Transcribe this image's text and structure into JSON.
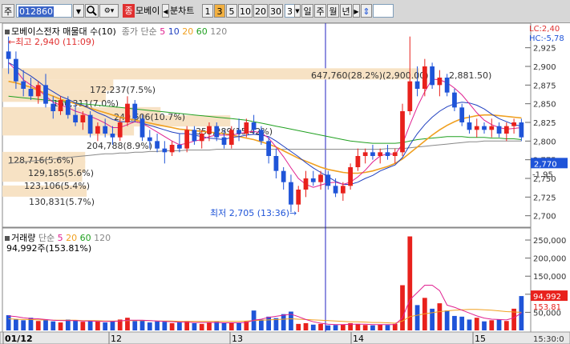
{
  "toolbar": {
    "mode": "주",
    "code": "012860",
    "stock_btn": "종",
    "stock_name": "모베이",
    "period_label": "분차트",
    "periods": [
      "1",
      "3",
      "5",
      "10",
      "20",
      "30"
    ],
    "active_period": "3",
    "count": "3",
    "ranges": [
      "일",
      "주",
      "월",
      "년"
    ]
  },
  "price_panel": {
    "legend_name": "모베이스전자 매물대 수(10)",
    "legend_ma_label": "종가 단순",
    "ma_periods": [
      "5",
      "10",
      "20",
      "60",
      "120"
    ],
    "lc": "LC:2,40",
    "hc": "HC:-5,78",
    "high_label": "최고 2,940 (11:09)",
    "low_label": "최저 2,705 (13:36)",
    "profile_labels": [
      "172,237(7.5%)",
      "160,311(7.0%)",
      "240,606(10.7%)",
      "204,788(8.9%)",
      "353,289(15.42%)",
      "128,716(5.6%)",
      "129,185(5.6%)",
      "123,106(5.4%)",
      "130,831(5.7%)",
      "647,760(28.2%)(2,900.00)",
      "2,881.50)"
    ],
    "y_ticks": [
      "2,925",
      "2,900",
      "2,875",
      "2,850",
      "2,825",
      "2,800",
      "2,775",
      "2,750",
      "2,725",
      "2,700"
    ],
    "current_price": "2,770",
    "side_value": "-1.95"
  },
  "volume_panel": {
    "legend_name": "거래량",
    "legend_ma_label": "단순",
    "ma_periods": [
      "5",
      "20",
      "60",
      "120"
    ],
    "last_volume": "94,992주(153.81%)",
    "y_ticks": [
      "250,000",
      "200,000",
      "150,000",
      "100,000",
      "50,000"
    ],
    "current_volume": "94,992",
    "current_pct": "153.81"
  },
  "x_axis": {
    "labels": [
      "01/12",
      "12",
      "13",
      "14",
      "15"
    ],
    "time": "15:30:0"
  },
  "colors": {
    "up": "#e8211c",
    "down": "#1f54d8",
    "ma5": "#e02090",
    "ma10": "#2040c0",
    "ma20": "#f0a020",
    "ma60": "#20a020",
    "ma120": "#888888"
  },
  "chart_data": {
    "type": "candlestick",
    "y_range": [
      2690,
      2945
    ],
    "volume_range": [
      0,
      270000
    ],
    "candles": [
      [
        2920,
        2940,
        2890,
        2910
      ],
      [
        2910,
        2920,
        2870,
        2880
      ],
      [
        2880,
        2895,
        2860,
        2870
      ],
      [
        2870,
        2885,
        2855,
        2860
      ],
      [
        2860,
        2880,
        2850,
        2875
      ],
      [
        2875,
        2890,
        2845,
        2850
      ],
      [
        2850,
        2860,
        2830,
        2840
      ],
      [
        2840,
        2860,
        2835,
        2855
      ],
      [
        2855,
        2860,
        2830,
        2835
      ],
      [
        2835,
        2850,
        2820,
        2825
      ],
      [
        2825,
        2840,
        2815,
        2835
      ],
      [
        2835,
        2840,
        2805,
        2810
      ],
      [
        2810,
        2825,
        2800,
        2820
      ],
      [
        2820,
        2830,
        2805,
        2810
      ],
      [
        2810,
        2820,
        2795,
        2805
      ],
      [
        2805,
        2830,
        2800,
        2825
      ],
      [
        2825,
        2860,
        2820,
        2850
      ],
      [
        2850,
        2855,
        2825,
        2830
      ],
      [
        2830,
        2835,
        2800,
        2805
      ],
      [
        2805,
        2815,
        2790,
        2800
      ],
      [
        2800,
        2810,
        2785,
        2790
      ],
      [
        2790,
        2800,
        2770,
        2785
      ],
      [
        2785,
        2800,
        2780,
        2795
      ],
      [
        2795,
        2810,
        2785,
        2790
      ],
      [
        2790,
        2820,
        2785,
        2815
      ],
      [
        2815,
        2820,
        2795,
        2800
      ],
      [
        2800,
        2815,
        2790,
        2810
      ],
      [
        2810,
        2825,
        2800,
        2820
      ],
      [
        2820,
        2825,
        2800,
        2805
      ],
      [
        2805,
        2815,
        2790,
        2795
      ],
      [
        2795,
        2820,
        2790,
        2815
      ],
      [
        2815,
        2830,
        2800,
        2810
      ],
      [
        2810,
        2830,
        2805,
        2825
      ],
      [
        2825,
        2835,
        2810,
        2815
      ],
      [
        2815,
        2820,
        2795,
        2800
      ],
      [
        2800,
        2805,
        2770,
        2780
      ],
      [
        2780,
        2790,
        2750,
        2760
      ],
      [
        2760,
        2765,
        2735,
        2745
      ],
      [
        2745,
        2755,
        2705,
        2715
      ],
      [
        2715,
        2740,
        2705,
        2735
      ],
      [
        2735,
        2760,
        2725,
        2750
      ],
      [
        2750,
        2760,
        2740,
        2745
      ],
      [
        2745,
        2760,
        2735,
        2755
      ],
      [
        2755,
        2760,
        2735,
        2740
      ],
      [
        2740,
        2750,
        2725,
        2730
      ],
      [
        2730,
        2745,
        2720,
        2740
      ],
      [
        2740,
        2770,
        2735,
        2765
      ],
      [
        2765,
        2790,
        2760,
        2780
      ],
      [
        2780,
        2790,
        2770,
        2785
      ],
      [
        2785,
        2795,
        2775,
        2780
      ],
      [
        2780,
        2790,
        2770,
        2785
      ],
      [
        2785,
        2795,
        2775,
        2780
      ],
      [
        2780,
        2790,
        2770,
        2785
      ],
      [
        2785,
        2850,
        2780,
        2840
      ],
      [
        2840,
        2940,
        2835,
        2880
      ],
      [
        2880,
        2900,
        2860,
        2870
      ],
      [
        2870,
        2910,
        2860,
        2900
      ],
      [
        2900,
        2905,
        2870,
        2875
      ],
      [
        2875,
        2895,
        2860,
        2885
      ],
      [
        2885,
        2890,
        2860,
        2865
      ],
      [
        2865,
        2870,
        2840,
        2845
      ],
      [
        2845,
        2850,
        2820,
        2825
      ],
      [
        2825,
        2835,
        2810,
        2815
      ],
      [
        2815,
        2830,
        2805,
        2820
      ],
      [
        2820,
        2825,
        2810,
        2815
      ],
      [
        2815,
        2830,
        2805,
        2820
      ],
      [
        2820,
        2825,
        2805,
        2810
      ],
      [
        2810,
        2825,
        2800,
        2820
      ],
      [
        2820,
        2830,
        2810,
        2825
      ],
      [
        2825,
        2830,
        2800,
        2805
      ]
    ],
    "volumes": [
      42000,
      30000,
      28000,
      35000,
      26000,
      30000,
      25000,
      22000,
      30000,
      28000,
      24000,
      27000,
      25000,
      22000,
      26000,
      30000,
      35000,
      26000,
      28000,
      22000,
      25000,
      24000,
      20000,
      22000,
      26000,
      20000,
      18000,
      22000,
      24000,
      20000,
      22000,
      20000,
      25000,
      55000,
      30000,
      38000,
      34000,
      45000,
      52000,
      18000,
      20000,
      16000,
      18000,
      14000,
      15000,
      16000,
      20000,
      18000,
      15000,
      14000,
      16000,
      15000,
      18000,
      125000,
      260000,
      70000,
      90000,
      60000,
      75000,
      55000,
      40000,
      38000,
      30000,
      35000,
      25000,
      28000,
      30000,
      26000,
      60000,
      94992
    ],
    "ma5": [
      2905,
      2895,
      2882,
      2875,
      2869,
      2860,
      2852,
      2848,
      2845,
      2840,
      2837,
      2833,
      2829,
      2824,
      2818,
      2818,
      2822,
      2826,
      2824,
      2818,
      2812,
      2806,
      2800,
      2795,
      2797,
      2800,
      2802,
      2806,
      2808,
      2808,
      2808,
      2810,
      2812,
      2813,
      2811,
      2804,
      2792,
      2779,
      2764,
      2750,
      2742,
      2738,
      2741,
      2744,
      2745,
      2742,
      2745,
      2752,
      2761,
      2772,
      2780,
      2783,
      2782,
      2796,
      2822,
      2846,
      2866,
      2883,
      2882,
      2878,
      2871,
      2862,
      2850,
      2838,
      2828,
      2822,
      2818,
      2816,
      2817,
      2818
    ],
    "ma10": [
      2905,
      2900,
      2893,
      2887,
      2880,
      2872,
      2866,
      2860,
      2856,
      2851,
      2848,
      2843,
      2838,
      2834,
      2829,
      2826,
      2826,
      2826,
      2824,
      2821,
      2818,
      2815,
      2812,
      2810,
      2810,
      2808,
      2806,
      2804,
      2803,
      2802,
      2805,
      2806,
      2808,
      2809,
      2808,
      2806,
      2800,
      2793,
      2786,
      2779,
      2771,
      2764,
      2758,
      2752,
      2746,
      2742,
      2742,
      2745,
      2750,
      2754,
      2760,
      2764,
      2768,
      2778,
      2795,
      2810,
      2822,
      2832,
      2840,
      2846,
      2850,
      2852,
      2851,
      2848,
      2843,
      2836,
      2830,
      2826,
      2822,
      2820
    ],
    "ma20": [
      2880,
      2878,
      2875,
      2872,
      2868,
      2864,
      2860,
      2856,
      2853,
      2850,
      2847,
      2844,
      2841,
      2838,
      2835,
      2832,
      2830,
      2828,
      2826,
      2824,
      2822,
      2820,
      2818,
      2816,
      2815,
      2814,
      2813,
      2812,
      2811,
      2810,
      2808,
      2806,
      2804,
      2802,
      2799,
      2796,
      2792,
      2787,
      2782,
      2777,
      2773,
      2769,
      2765,
      2762,
      2760,
      2758,
      2757,
      2757,
      2758,
      2760,
      2763,
      2766,
      2770,
      2776,
      2784,
      2792,
      2800,
      2808,
      2815,
      2821,
      2826,
      2830,
      2832,
      2834,
      2835,
      2835,
      2834,
      2833,
      2832,
      2831
    ],
    "ma60": [
      2860,
      2859,
      2858,
      2857,
      2856,
      2855,
      2854,
      2853,
      2852,
      2851,
      2850,
      2849,
      2848,
      2847,
      2846,
      2845,
      2844,
      2843,
      2842,
      2841,
      2840,
      2839,
      2838,
      2837,
      2836,
      2835,
      2834,
      2833,
      2832,
      2831,
      2830,
      2829,
      2828,
      2826,
      2824,
      2822,
      2820,
      2818,
      2816,
      2814,
      2812,
      2810,
      2808,
      2806,
      2804,
      2802,
      2800,
      2799,
      2798,
      2797,
      2797,
      2797,
      2797,
      2798,
      2800,
      2802,
      2803,
      2804,
      2805,
      2806,
      2806,
      2806,
      2805,
      2805,
      2805,
      2804,
      2804,
      2803,
      2803,
      2802
    ],
    "ma120": [
      2770,
      2771,
      2772,
      2773,
      2774,
      2775,
      2776,
      2777,
      2778,
      2779,
      2780,
      2781,
      2782,
      2783,
      2783,
      2784,
      2784,
      2785,
      2785,
      2786,
      2786,
      2787,
      2787,
      2787,
      2788,
      2788,
      2788,
      2788,
      2789,
      2789,
      2789,
      2789,
      2789,
      2789,
      2789,
      2789,
      2789,
      2789,
      2789,
      2789,
      2789,
      2789,
      2789,
      2789,
      2789,
      2789,
      2789,
      2789,
      2789,
      2789,
      2789,
      2790,
      2790,
      2790,
      2791,
      2792,
      2793,
      2794,
      2795,
      2796,
      2797,
      2798,
      2799,
      2799,
      2800,
      2800,
      2800,
      2800,
      2800,
      2800
    ],
    "vol_ma5": [
      40000,
      38000,
      35000,
      33000,
      32000,
      30000,
      28000,
      27000,
      27000,
      27000,
      26000,
      26000,
      25000,
      25000,
      25000,
      26000,
      28000,
      28000,
      28000,
      27000,
      26000,
      25000,
      24000,
      23000,
      23000,
      22000,
      22000,
      22000,
      22000,
      21000,
      21000,
      21000,
      22000,
      28000,
      31000,
      36000,
      39000,
      42000,
      45000,
      38000,
      30000,
      24000,
      20000,
      17000,
      16000,
      16000,
      17000,
      17000,
      17000,
      16000,
      16000,
      16000,
      16000,
      35000,
      85000,
      105000,
      125000,
      125000,
      110000,
      70000,
      64000,
      56000,
      48000,
      40000,
      34000,
      31000,
      30000,
      29000,
      35000,
      48000
    ],
    "vol_ma20": [
      32000,
      31000,
      30000,
      30000,
      29000,
      29000,
      28000,
      28000,
      28000,
      28000,
      27000,
      27000,
      27000,
      26000,
      26000,
      26000,
      27000,
      27000,
      27000,
      27000,
      26000,
      26000,
      26000,
      25000,
      25000,
      25000,
      25000,
      25000,
      25000,
      25000,
      25000,
      25000,
      26000,
      27000,
      28000,
      29000,
      30000,
      31000,
      32000,
      31000,
      30000,
      29000,
      28000,
      27000,
      26000,
      25000,
      24000,
      24000,
      23000,
      22000,
      22000,
      21000,
      20000,
      26000,
      38000,
      42000,
      46000,
      49000,
      52000,
      54000,
      56000,
      57000,
      58000,
      58000,
      57000,
      56000,
      54000,
      52000,
      51000,
      50000
    ],
    "volume_profile": [
      {
        "price": 2875,
        "pct": 7.5
      },
      {
        "price": 2860,
        "pct": 7.0
      },
      {
        "price": 2838,
        "pct": 10.7
      },
      {
        "price": 2815,
        "pct": 8.9
      },
      {
        "price": 2827,
        "pct": 15.42
      },
      {
        "price": 2778,
        "pct": 5.6
      },
      {
        "price": 2766,
        "pct": 5.6
      },
      {
        "price": 2753,
        "pct": 5.4
      },
      {
        "price": 2733,
        "pct": 5.7
      },
      {
        "price": 2890,
        "pct": 28.2
      }
    ]
  }
}
